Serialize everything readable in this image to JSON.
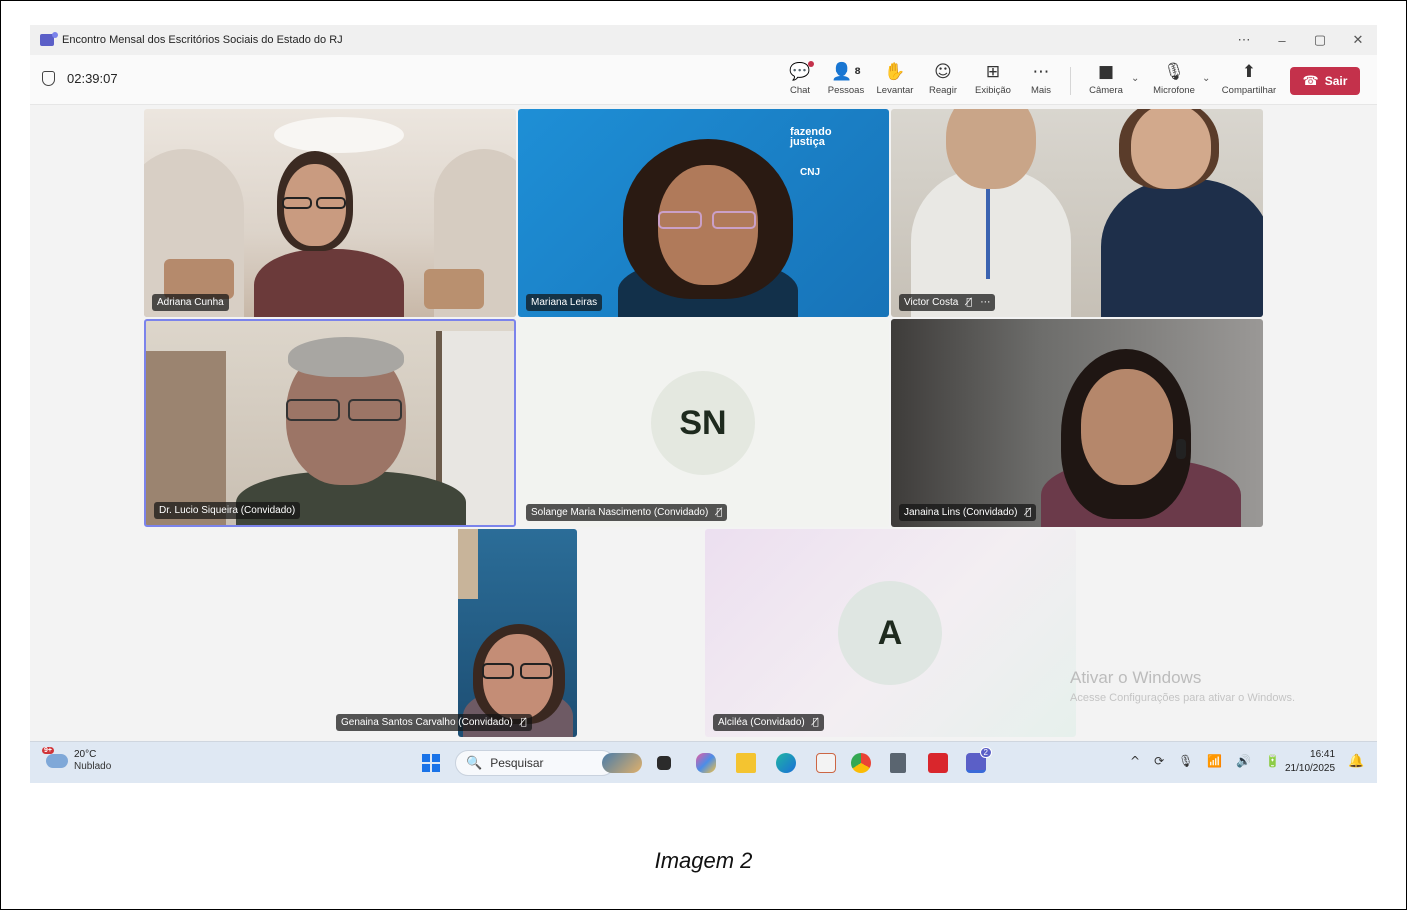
{
  "window": {
    "title": "Encontro Mensal dos Escritórios Sociais do Estado do RJ",
    "controls": [
      "⋯",
      "–",
      "▢",
      "✕"
    ]
  },
  "toolbar": {
    "timer": "02:39:07",
    "people_count": "8",
    "buttons": {
      "chat": "Chat",
      "people": "Pessoas",
      "raise": "Levantar",
      "react": "Reagir",
      "view": "Exibição",
      "more": "Mais",
      "camera": "Câmera",
      "mic": "Microfone",
      "share": "Compartilhar"
    },
    "leave": "Sair"
  },
  "participants": [
    {
      "name": "Adriana Cunha"
    },
    {
      "name": "Mariana Leiras"
    },
    {
      "name": "Victor Costa"
    },
    {
      "name": "Dr. Lucio Siqueira (Convidado)"
    },
    {
      "name": "Solange Maria Nascimento (Convidado)",
      "initials": "SN"
    },
    {
      "name": "Janaina Lins (Convidado)"
    },
    {
      "name": "Genaina Santos Carvalho (Convidado)"
    },
    {
      "name": "Alciléa (Convidado)",
      "initials": "A"
    }
  ],
  "overlays": {
    "logo_line1": "fazendo",
    "logo_line2": "justiça",
    "logo_cnj": "CNJ"
  },
  "watermark": {
    "line1": "Ativar o Windows",
    "line2": "Acesse Configurações para ativar o Windows."
  },
  "taskbar": {
    "weather_badge": "9+",
    "temperature": "20°C",
    "condition": "Nublado",
    "search_placeholder": "Pesquisar",
    "teams_badge": "2",
    "time": "16:41",
    "date": "21/10/2025"
  },
  "caption": "Imagem 2"
}
